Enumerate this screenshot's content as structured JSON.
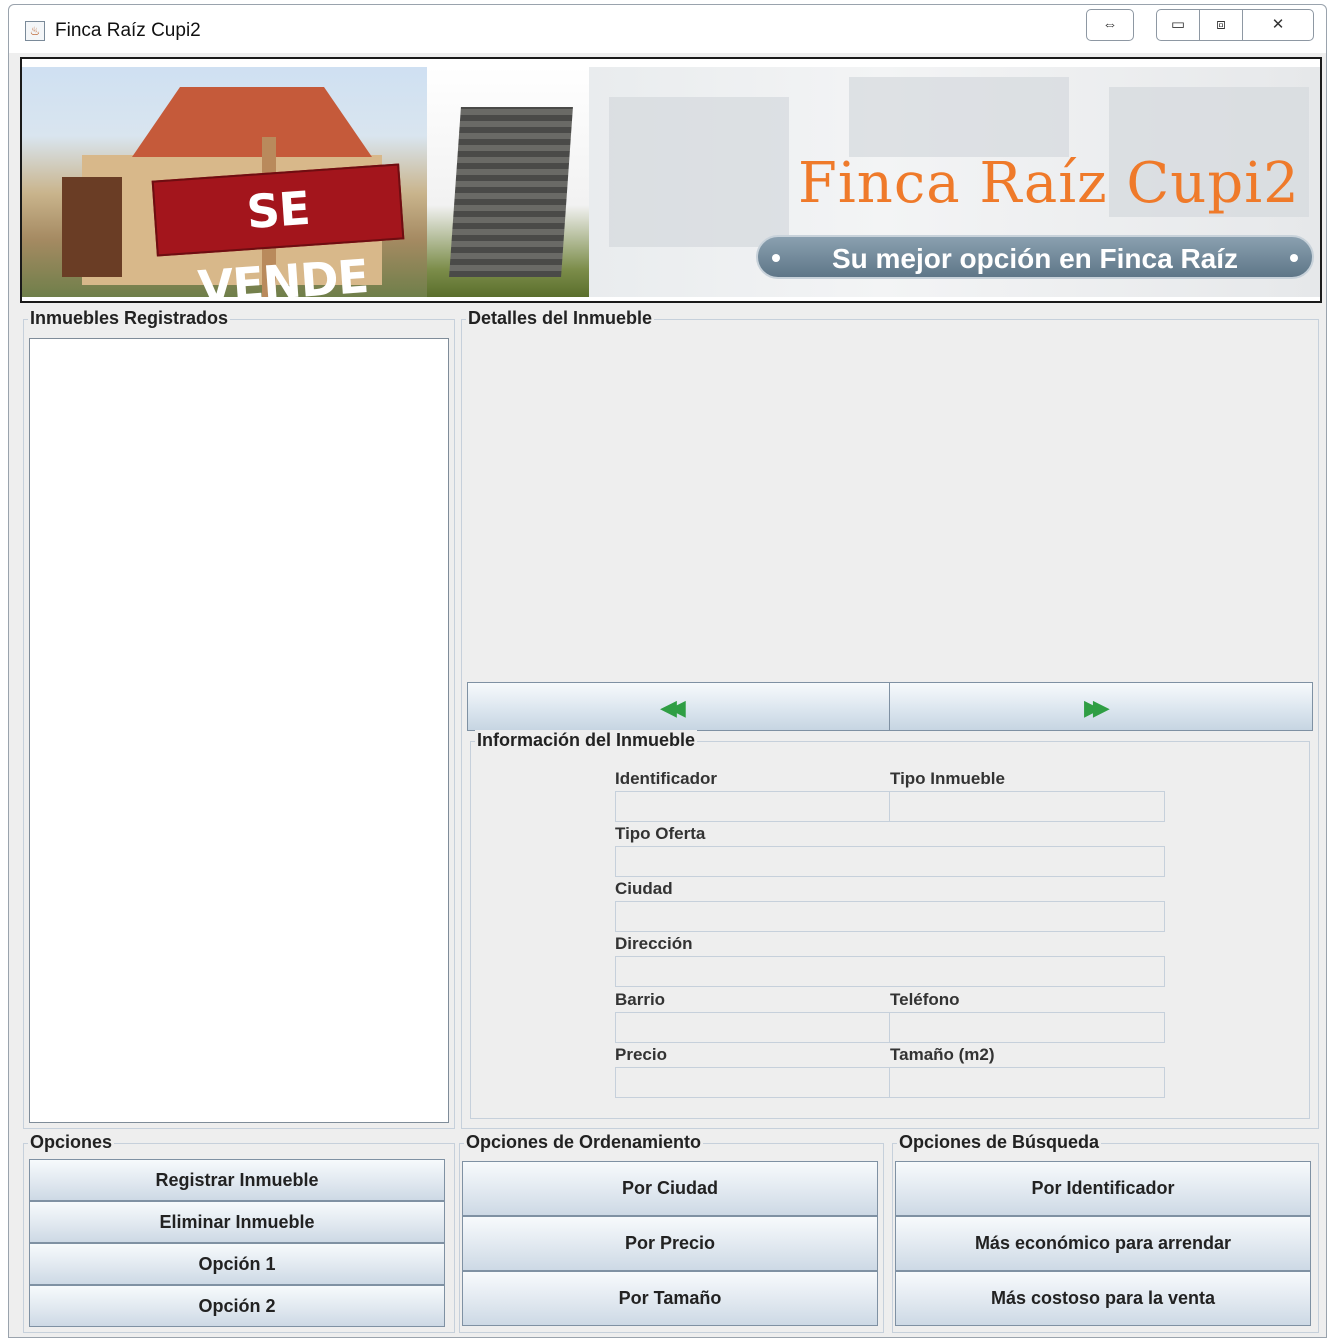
{
  "window": {
    "title": "Finca Raíz Cupi2",
    "controls": {
      "swap": "⇔",
      "minimize": "▭",
      "maximize": "⧈",
      "close": "✕"
    }
  },
  "banner": {
    "sign_text": "SE VENDE",
    "title": "Finca Raíz Cupi2",
    "slogan": "Su mejor opción en Finca Raíz"
  },
  "registered": {
    "title": "Inmuebles Registrados",
    "items": []
  },
  "details": {
    "title": "Detalles del Inmueble",
    "prev_icon": "rewind-icon",
    "next_icon": "fast-forward-icon",
    "prev_glyph": "◀◀",
    "next_glyph": "▶▶"
  },
  "info": {
    "title": "Información del Inmueble",
    "labels": {
      "identificador": "Identificador",
      "tipo_inmueble": "Tipo Inmueble",
      "tipo_oferta": "Tipo Oferta",
      "ciudad": "Ciudad",
      "direccion": "Dirección",
      "barrio": "Barrio",
      "telefono": "Teléfono",
      "precio": "Precio",
      "tamano": "Tamaño (m2)"
    },
    "values": {
      "identificador": "",
      "tipo_inmueble": "",
      "tipo_oferta": "",
      "ciudad": "",
      "direccion": "",
      "barrio": "",
      "telefono": "",
      "precio": "",
      "tamano": ""
    }
  },
  "opciones": {
    "title": "Opciones",
    "buttons": [
      "Registrar Inmueble",
      "Eliminar Inmueble",
      "Opción 1",
      "Opción 2"
    ]
  },
  "ordenamiento": {
    "title": "Opciones de Ordenamiento",
    "buttons": [
      "Por Ciudad",
      "Por Precio",
      "Por Tamaño"
    ]
  },
  "busqueda": {
    "title": "Opciones de Búsqueda",
    "buttons": [
      "Por Identificador",
      "Más económico para arrendar",
      "Más costoso para la venta"
    ]
  },
  "colors": {
    "window_bg": "#eeeeee",
    "banner_title": "#ef7a2a",
    "sign_red": "#a3151c",
    "arrow_green": "#2f9e44"
  }
}
